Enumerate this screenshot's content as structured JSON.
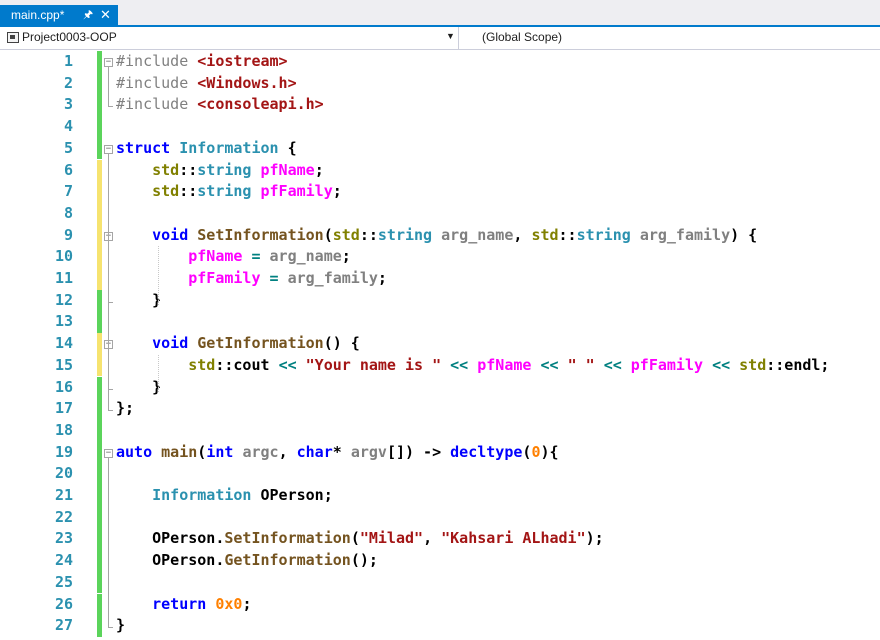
{
  "tab": {
    "title": "main.cpp*",
    "pin_icon": "pin-icon",
    "close_icon": "close-icon"
  },
  "navbar": {
    "project": "Project0003-OOP",
    "scope": "(Global Scope)"
  },
  "colors": {
    "accent": "#007acc",
    "line_number": "#2b91af",
    "keyword": "#0000ff",
    "type": "#2b91af",
    "member": "#ff00ff",
    "function": "#74531f",
    "string": "#a31515",
    "number": "#ff8000",
    "preprocessor": "#808080",
    "namespace": "#808000",
    "parameter": "#808080",
    "operator": "#008080",
    "change_saved": "#5bd45b",
    "change_unsaved": "#f6e36f"
  },
  "code": {
    "lines": [
      {
        "number": "1",
        "change": "saved",
        "fold": "start",
        "tokens": [
          [
            "pp",
            "#include "
          ],
          [
            "str",
            "<iostream>"
          ]
        ]
      },
      {
        "number": "2",
        "change": "saved",
        "tokens": [
          [
            "pp",
            "#include "
          ],
          [
            "str",
            "<Windows.h>"
          ]
        ]
      },
      {
        "number": "3",
        "change": "saved",
        "fold": "end",
        "tokens": [
          [
            "pp",
            "#include "
          ],
          [
            "str",
            "<consoleapi.h>"
          ]
        ]
      },
      {
        "number": "4",
        "change": "saved",
        "tokens": []
      },
      {
        "number": "5",
        "change": "saved",
        "fold": "start",
        "tokens": [
          [
            "kw",
            "struct "
          ],
          [
            "type",
            "Information"
          ],
          [
            "txt",
            " {"
          ]
        ]
      },
      {
        "number": "6",
        "change": "unsaved",
        "tokens": [
          [
            "ind",
            "    "
          ],
          [
            "ns",
            "std"
          ],
          [
            "txt",
            "::"
          ],
          [
            "type",
            "string "
          ],
          [
            "mem",
            "pfName"
          ],
          [
            "txt",
            ";"
          ]
        ]
      },
      {
        "number": "7",
        "change": "unsaved",
        "tokens": [
          [
            "ind",
            "    "
          ],
          [
            "ns",
            "std"
          ],
          [
            "txt",
            "::"
          ],
          [
            "type",
            "string "
          ],
          [
            "mem",
            "pfFamily"
          ],
          [
            "txt",
            ";"
          ]
        ]
      },
      {
        "number": "8",
        "change": "unsaved",
        "tokens": []
      },
      {
        "number": "9",
        "change": "unsaved",
        "fold": "start",
        "tokens": [
          [
            "ind",
            "    "
          ],
          [
            "kw",
            "void "
          ],
          [
            "fn",
            "SetInformation"
          ],
          [
            "txt",
            "("
          ],
          [
            "ns",
            "std"
          ],
          [
            "txt",
            "::"
          ],
          [
            "type",
            "string "
          ],
          [
            "par",
            "arg_name"
          ],
          [
            "txt",
            ", "
          ],
          [
            "ns",
            "std"
          ],
          [
            "txt",
            "::"
          ],
          [
            "type",
            "string "
          ],
          [
            "par",
            "arg_family"
          ],
          [
            "txt",
            ") {"
          ]
        ]
      },
      {
        "number": "10",
        "change": "unsaved",
        "tokens": [
          [
            "ind",
            "        "
          ],
          [
            "mem",
            "pfName"
          ],
          [
            "op",
            " = "
          ],
          [
            "par",
            "arg_name"
          ],
          [
            "txt",
            ";"
          ]
        ]
      },
      {
        "number": "11",
        "change": "unsaved",
        "tokens": [
          [
            "ind",
            "        "
          ],
          [
            "mem",
            "pfFamily"
          ],
          [
            "op",
            " = "
          ],
          [
            "par",
            "arg_family"
          ],
          [
            "txt",
            ";"
          ]
        ]
      },
      {
        "number": "12",
        "change": "saved",
        "fold": "end",
        "tokens": [
          [
            "ind",
            "    "
          ],
          [
            "txt",
            "}"
          ]
        ]
      },
      {
        "number": "13",
        "change": "saved",
        "tokens": []
      },
      {
        "number": "14",
        "change": "unsaved",
        "fold": "start",
        "tokens": [
          [
            "ind",
            "    "
          ],
          [
            "kw",
            "void "
          ],
          [
            "fn",
            "GetInformation"
          ],
          [
            "txt",
            "() {"
          ]
        ]
      },
      {
        "number": "15",
        "change": "unsaved",
        "tokens": [
          [
            "ind",
            "        "
          ],
          [
            "ns",
            "std"
          ],
          [
            "txt",
            "::cout "
          ],
          [
            "op",
            "<< "
          ],
          [
            "str",
            "\"Your name is \" "
          ],
          [
            "op",
            "<< "
          ],
          [
            "mem",
            "pfName "
          ],
          [
            "op",
            "<< "
          ],
          [
            "str",
            "\" \" "
          ],
          [
            "op",
            "<< "
          ],
          [
            "mem",
            "pfFamily "
          ],
          [
            "op",
            "<< "
          ],
          [
            "ns",
            "std"
          ],
          [
            "txt",
            "::endl;"
          ]
        ]
      },
      {
        "number": "16",
        "change": "saved",
        "fold": "end",
        "tokens": [
          [
            "ind",
            "    "
          ],
          [
            "txt",
            "}"
          ]
        ]
      },
      {
        "number": "17",
        "change": "saved",
        "fold": "end",
        "tokens": [
          [
            "txt",
            "};"
          ]
        ]
      },
      {
        "number": "18",
        "change": "saved",
        "tokens": []
      },
      {
        "number": "19",
        "change": "saved",
        "fold": "start",
        "tokens": [
          [
            "kw",
            "auto "
          ],
          [
            "fn",
            "main"
          ],
          [
            "txt",
            "("
          ],
          [
            "kw",
            "int "
          ],
          [
            "par",
            "argc"
          ],
          [
            "txt",
            ", "
          ],
          [
            "kw",
            "char"
          ],
          [
            "txt",
            "* "
          ],
          [
            "par",
            "argv"
          ],
          [
            "txt",
            "[]) -> "
          ],
          [
            "kw",
            "decltype"
          ],
          [
            "txt",
            "("
          ],
          [
            "num",
            "0"
          ],
          [
            "txt",
            "){"
          ]
        ]
      },
      {
        "number": "20",
        "change": "saved",
        "tokens": []
      },
      {
        "number": "21",
        "change": "saved",
        "tokens": [
          [
            "ind",
            "    "
          ],
          [
            "type",
            "Information "
          ],
          [
            "txt",
            "OPerson;"
          ]
        ]
      },
      {
        "number": "22",
        "change": "saved",
        "tokens": []
      },
      {
        "number": "23",
        "change": "saved",
        "tokens": [
          [
            "ind",
            "    "
          ],
          [
            "txt",
            "OPerson."
          ],
          [
            "fn",
            "SetInformation"
          ],
          [
            "txt",
            "("
          ],
          [
            "str",
            "\"Milad\""
          ],
          [
            "txt",
            ", "
          ],
          [
            "str",
            "\"Kahsari ALhadi\""
          ],
          [
            "txt",
            ");"
          ]
        ]
      },
      {
        "number": "24",
        "change": "saved",
        "tokens": [
          [
            "ind",
            "    "
          ],
          [
            "txt",
            "OPerson."
          ],
          [
            "fn",
            "GetInformation"
          ],
          [
            "txt",
            "();"
          ]
        ]
      },
      {
        "number": "25",
        "change": "saved",
        "tokens": []
      },
      {
        "number": "26",
        "change": "saved",
        "tokens": [
          [
            "ind",
            "    "
          ],
          [
            "kw",
            "return "
          ],
          [
            "num",
            "0x0"
          ],
          [
            "txt",
            ";"
          ]
        ]
      },
      {
        "number": "27",
        "change": "saved",
        "fold": "end",
        "tokens": [
          [
            "txt",
            "}"
          ]
        ]
      }
    ]
  }
}
